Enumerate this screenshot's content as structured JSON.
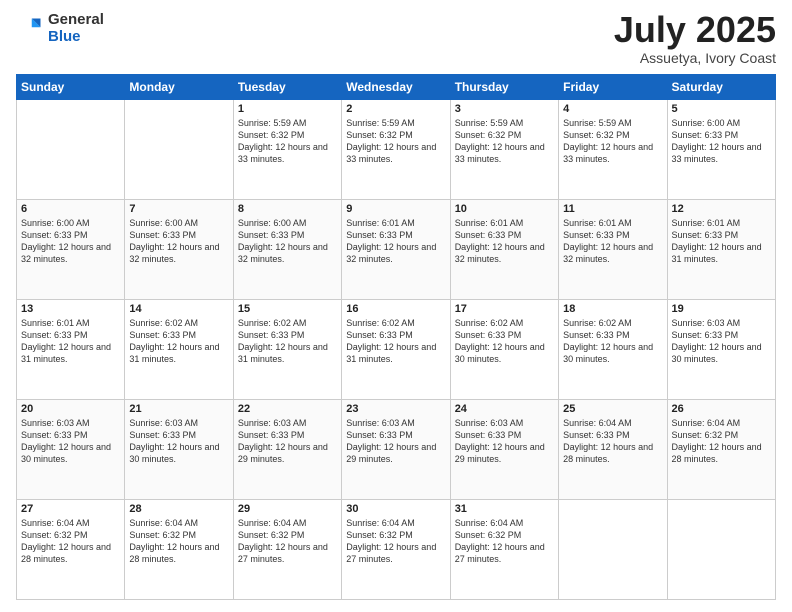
{
  "header": {
    "logo_general": "General",
    "logo_blue": "Blue",
    "month_title": "July 2025",
    "location": "Assuetya, Ivory Coast"
  },
  "calendar": {
    "days_of_week": [
      "Sunday",
      "Monday",
      "Tuesday",
      "Wednesday",
      "Thursday",
      "Friday",
      "Saturday"
    ],
    "weeks": [
      [
        {
          "day": "",
          "info": ""
        },
        {
          "day": "",
          "info": ""
        },
        {
          "day": "1",
          "info": "Sunrise: 5:59 AM\nSunset: 6:32 PM\nDaylight: 12 hours and 33 minutes."
        },
        {
          "day": "2",
          "info": "Sunrise: 5:59 AM\nSunset: 6:32 PM\nDaylight: 12 hours and 33 minutes."
        },
        {
          "day": "3",
          "info": "Sunrise: 5:59 AM\nSunset: 6:32 PM\nDaylight: 12 hours and 33 minutes."
        },
        {
          "day": "4",
          "info": "Sunrise: 5:59 AM\nSunset: 6:32 PM\nDaylight: 12 hours and 33 minutes."
        },
        {
          "day": "5",
          "info": "Sunrise: 6:00 AM\nSunset: 6:33 PM\nDaylight: 12 hours and 33 minutes."
        }
      ],
      [
        {
          "day": "6",
          "info": "Sunrise: 6:00 AM\nSunset: 6:33 PM\nDaylight: 12 hours and 32 minutes."
        },
        {
          "day": "7",
          "info": "Sunrise: 6:00 AM\nSunset: 6:33 PM\nDaylight: 12 hours and 32 minutes."
        },
        {
          "day": "8",
          "info": "Sunrise: 6:00 AM\nSunset: 6:33 PM\nDaylight: 12 hours and 32 minutes."
        },
        {
          "day": "9",
          "info": "Sunrise: 6:01 AM\nSunset: 6:33 PM\nDaylight: 12 hours and 32 minutes."
        },
        {
          "day": "10",
          "info": "Sunrise: 6:01 AM\nSunset: 6:33 PM\nDaylight: 12 hours and 32 minutes."
        },
        {
          "day": "11",
          "info": "Sunrise: 6:01 AM\nSunset: 6:33 PM\nDaylight: 12 hours and 32 minutes."
        },
        {
          "day": "12",
          "info": "Sunrise: 6:01 AM\nSunset: 6:33 PM\nDaylight: 12 hours and 31 minutes."
        }
      ],
      [
        {
          "day": "13",
          "info": "Sunrise: 6:01 AM\nSunset: 6:33 PM\nDaylight: 12 hours and 31 minutes."
        },
        {
          "day": "14",
          "info": "Sunrise: 6:02 AM\nSunset: 6:33 PM\nDaylight: 12 hours and 31 minutes."
        },
        {
          "day": "15",
          "info": "Sunrise: 6:02 AM\nSunset: 6:33 PM\nDaylight: 12 hours and 31 minutes."
        },
        {
          "day": "16",
          "info": "Sunrise: 6:02 AM\nSunset: 6:33 PM\nDaylight: 12 hours and 31 minutes."
        },
        {
          "day": "17",
          "info": "Sunrise: 6:02 AM\nSunset: 6:33 PM\nDaylight: 12 hours and 30 minutes."
        },
        {
          "day": "18",
          "info": "Sunrise: 6:02 AM\nSunset: 6:33 PM\nDaylight: 12 hours and 30 minutes."
        },
        {
          "day": "19",
          "info": "Sunrise: 6:03 AM\nSunset: 6:33 PM\nDaylight: 12 hours and 30 minutes."
        }
      ],
      [
        {
          "day": "20",
          "info": "Sunrise: 6:03 AM\nSunset: 6:33 PM\nDaylight: 12 hours and 30 minutes."
        },
        {
          "day": "21",
          "info": "Sunrise: 6:03 AM\nSunset: 6:33 PM\nDaylight: 12 hours and 30 minutes."
        },
        {
          "day": "22",
          "info": "Sunrise: 6:03 AM\nSunset: 6:33 PM\nDaylight: 12 hours and 29 minutes."
        },
        {
          "day": "23",
          "info": "Sunrise: 6:03 AM\nSunset: 6:33 PM\nDaylight: 12 hours and 29 minutes."
        },
        {
          "day": "24",
          "info": "Sunrise: 6:03 AM\nSunset: 6:33 PM\nDaylight: 12 hours and 29 minutes."
        },
        {
          "day": "25",
          "info": "Sunrise: 6:04 AM\nSunset: 6:33 PM\nDaylight: 12 hours and 28 minutes."
        },
        {
          "day": "26",
          "info": "Sunrise: 6:04 AM\nSunset: 6:32 PM\nDaylight: 12 hours and 28 minutes."
        }
      ],
      [
        {
          "day": "27",
          "info": "Sunrise: 6:04 AM\nSunset: 6:32 PM\nDaylight: 12 hours and 28 minutes."
        },
        {
          "day": "28",
          "info": "Sunrise: 6:04 AM\nSunset: 6:32 PM\nDaylight: 12 hours and 28 minutes."
        },
        {
          "day": "29",
          "info": "Sunrise: 6:04 AM\nSunset: 6:32 PM\nDaylight: 12 hours and 27 minutes."
        },
        {
          "day": "30",
          "info": "Sunrise: 6:04 AM\nSunset: 6:32 PM\nDaylight: 12 hours and 27 minutes."
        },
        {
          "day": "31",
          "info": "Sunrise: 6:04 AM\nSunset: 6:32 PM\nDaylight: 12 hours and 27 minutes."
        },
        {
          "day": "",
          "info": ""
        },
        {
          "day": "",
          "info": ""
        }
      ]
    ]
  }
}
